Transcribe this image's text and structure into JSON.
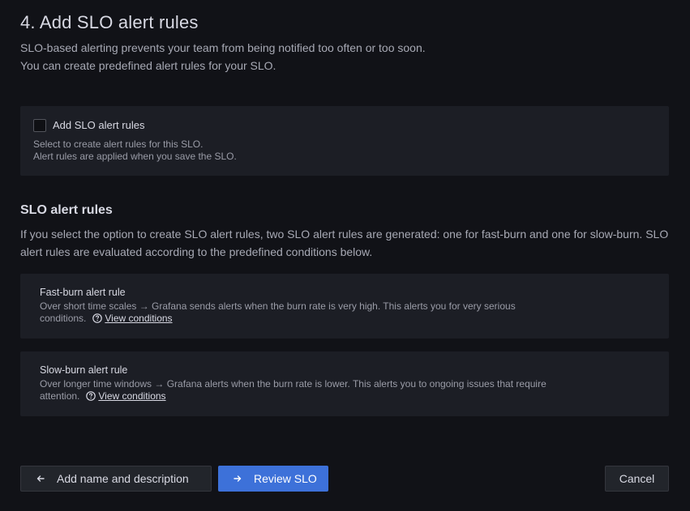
{
  "header": {
    "title": "4. Add SLO alert rules",
    "intro_line1": "SLO-based alerting prevents your team from being notified too often or too soon.",
    "intro_line2": "You can create predefined alert rules for your SLO."
  },
  "alert_option": {
    "checkbox_label": "Add SLO alert rules",
    "checked": false,
    "desc_line1": "Select to create alert rules for this SLO.",
    "desc_line2": "Alert rules are applied when you save the SLO."
  },
  "rules_section": {
    "title": "SLO alert rules",
    "description": "If you select the option to create SLO alert rules, two SLO alert rules are generated: one for fast-burn and one for slow-burn. SLO alert rules are evaluated according to the predefined conditions below.",
    "fast_burn": {
      "title": "Fast-burn alert rule",
      "description": "Over short time scales → Grafana sends alerts when the burn rate is very high. This alerts you for very serious conditions.",
      "link": "View conditions"
    },
    "slow_burn": {
      "title": "Slow-burn alert rule",
      "description": "Over longer time windows → Grafana alerts when the burn rate is lower. This alerts you to ongoing issues that require attention.",
      "link": "View conditions"
    }
  },
  "footer": {
    "back_label": "Add name and description",
    "next_label": "Review SLO",
    "cancel_label": "Cancel"
  },
  "colors": {
    "background": "#111217",
    "panel": "#1c1e25",
    "primary": "#3d71d9"
  },
  "icons": {
    "back": "arrow-left-icon",
    "next": "arrow-right-icon",
    "help": "question-circle-icon"
  }
}
